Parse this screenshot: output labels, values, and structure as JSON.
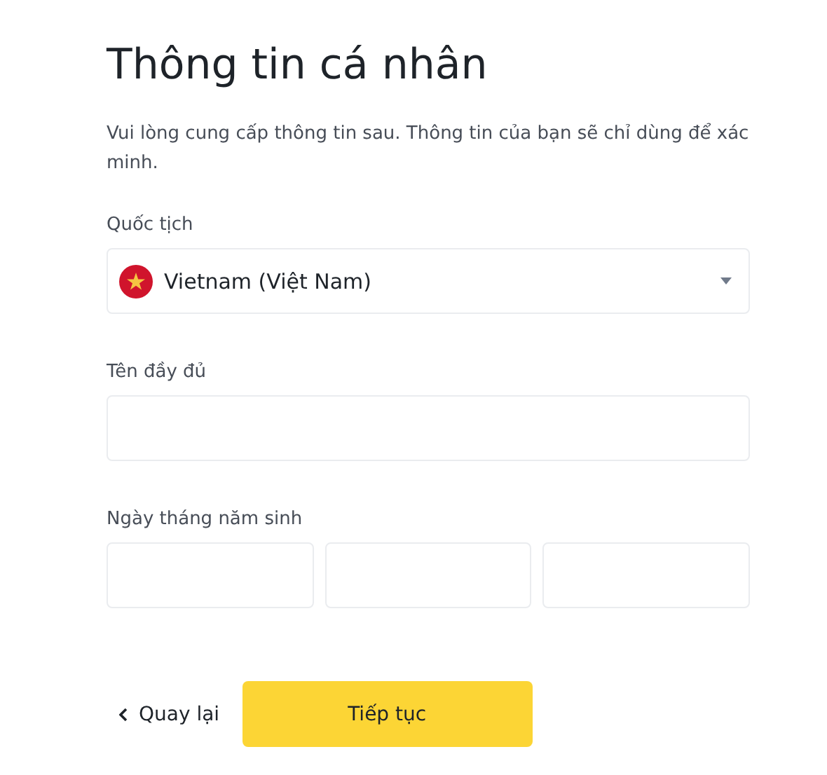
{
  "title": "Thông tin cá nhân",
  "description": "Vui lòng cung cấp thông tin sau. Thông tin của bạn sẽ chỉ dùng để xác minh.",
  "fields": [
    {
      "kind": "select",
      "label": "Quốc tịch",
      "value": "Vietnam (Việt Nam)"
    },
    {
      "kind": "text",
      "label": "Tên đầy đủ"
    },
    {
      "kind": "date",
      "label": "Ngày tháng năm sinh"
    }
  ],
  "back_button": {
    "label": "Quay lại"
  },
  "continue_button": {
    "label": "Tiếp tục"
  }
}
